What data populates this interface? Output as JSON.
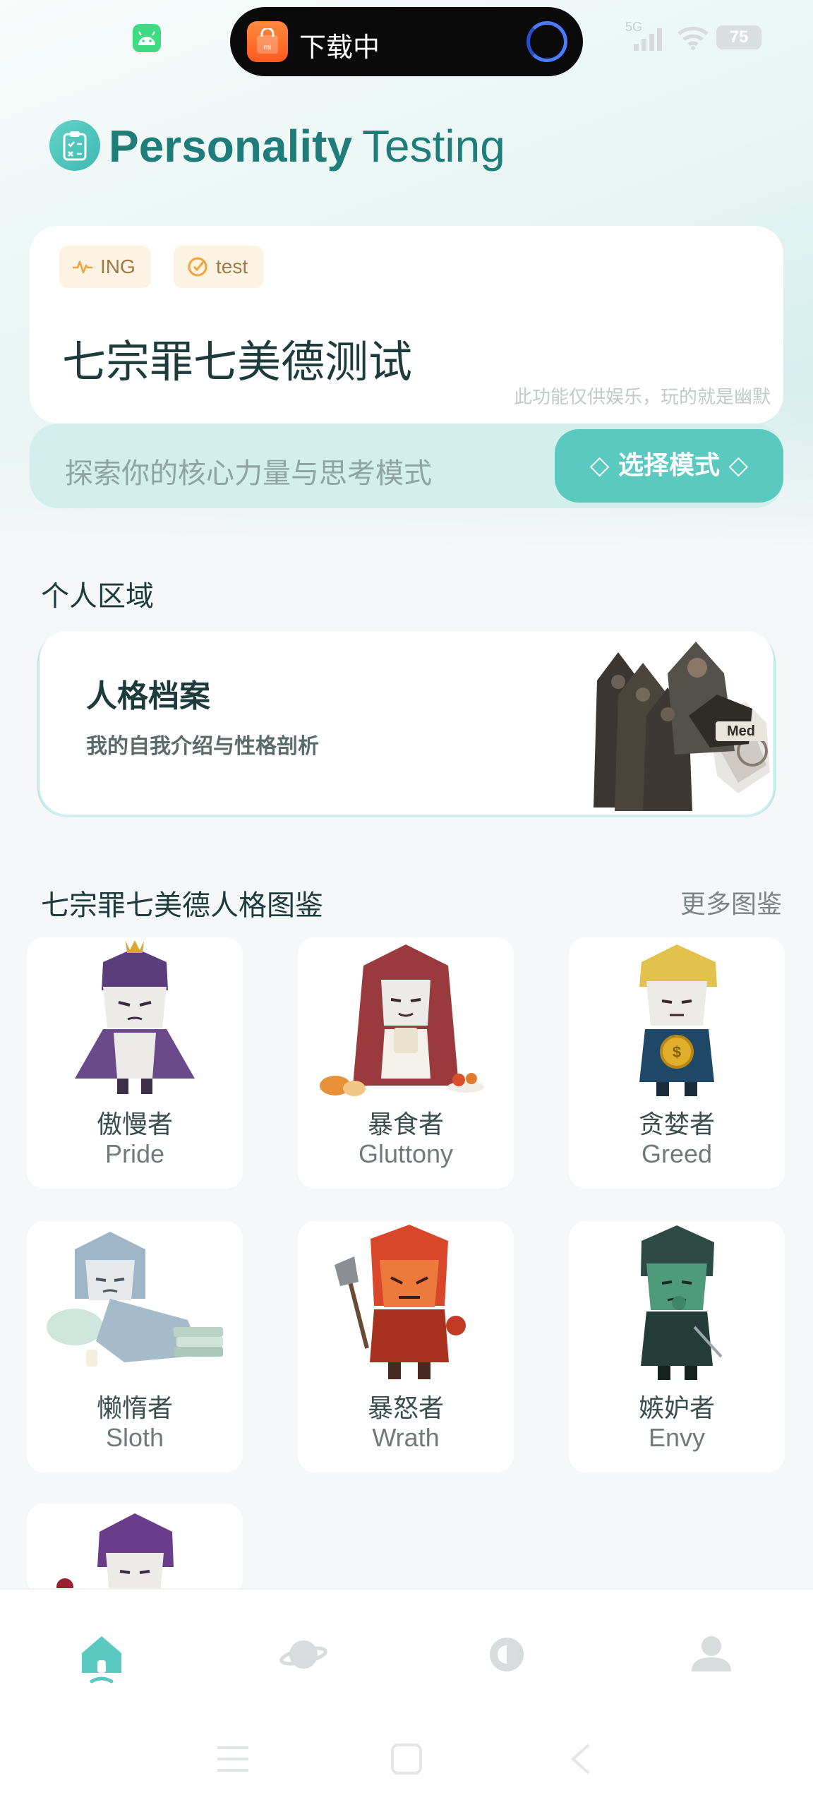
{
  "status_bar": {
    "download_label": "下载中",
    "network": "5G",
    "battery": "75"
  },
  "header": {
    "title_word1": "Personality",
    "title_word2": "Testing"
  },
  "test_card": {
    "tags": [
      "ING",
      "test"
    ],
    "title": "七宗罪七美德测试",
    "disclaimer": "此功能仅供娱乐，玩的就是幽默"
  },
  "search": {
    "placeholder": "探索你的核心力量与思考模式",
    "mode_button": "◇ 选择模式 ◇"
  },
  "personal_section": {
    "title": "个人区域",
    "card_title": "人格档案",
    "card_subtitle": "我的自我介绍与性格剖析"
  },
  "gallery": {
    "title": "七宗罪七美德人格图鉴",
    "more": "更多图鉴",
    "characters": [
      {
        "cn": "傲慢者",
        "en": "Pride"
      },
      {
        "cn": "暴食者",
        "en": "Gluttony"
      },
      {
        "cn": "贪婪者",
        "en": "Greed"
      },
      {
        "cn": "懒惰者",
        "en": "Sloth"
      },
      {
        "cn": "暴怒者",
        "en": "Wrath"
      },
      {
        "cn": "嫉妒者",
        "en": "Envy"
      }
    ]
  },
  "bottom_nav": {
    "items": [
      "home-icon",
      "planet-icon",
      "theme-icon",
      "user-icon"
    ],
    "active": "home-icon",
    "accent": "#5ac9bf"
  },
  "colors": {
    "accent": "#5ac9bf",
    "title": "#1e7d78"
  }
}
